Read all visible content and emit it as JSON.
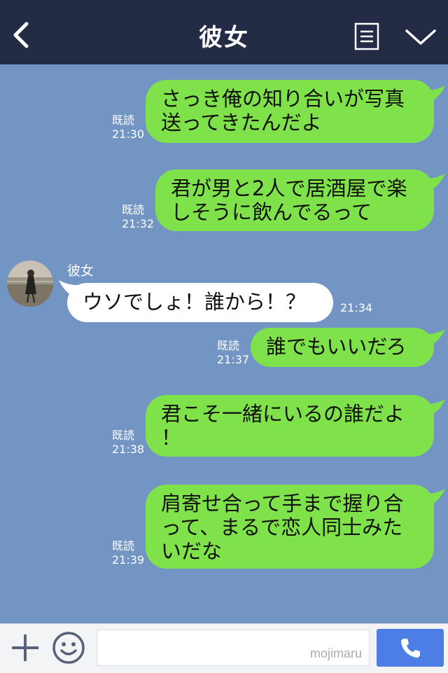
{
  "header": {
    "title": "彼女"
  },
  "messages": [
    {
      "dir": "out",
      "text": "さっき俺の知り合いが写真\n送ってきたんだよ",
      "read": "既読",
      "time": "21:30"
    },
    {
      "dir": "out",
      "text": "君が男と2人で居酒屋で楽\nしそうに飲んでるって",
      "read": "既読",
      "time": "21:32"
    },
    {
      "dir": "in",
      "sender": "彼女",
      "text": "ウソでしょ！誰から！？",
      "time": "21:34"
    },
    {
      "dir": "out",
      "text": "誰でもいいだろ",
      "read": "既読",
      "time": "21:37"
    },
    {
      "dir": "out",
      "text": "君こそ一緒にいるの誰だよ\n！",
      "read": "既読",
      "time": "21:38"
    },
    {
      "dir": "out",
      "text": "肩寄せ合って手まで握り合\nって、まるで恋人同士みた\nいだな",
      "read": "既読",
      "time": "21:39"
    }
  ],
  "input": {
    "placeholder": "",
    "watermark": "mojimaru"
  },
  "colors": {
    "header_bg": "#232c44",
    "chat_bg": "#7395c3",
    "outgoing_bubble": "#80e24a",
    "incoming_bubble": "#ffffff",
    "call_button": "#4d7ee6"
  }
}
